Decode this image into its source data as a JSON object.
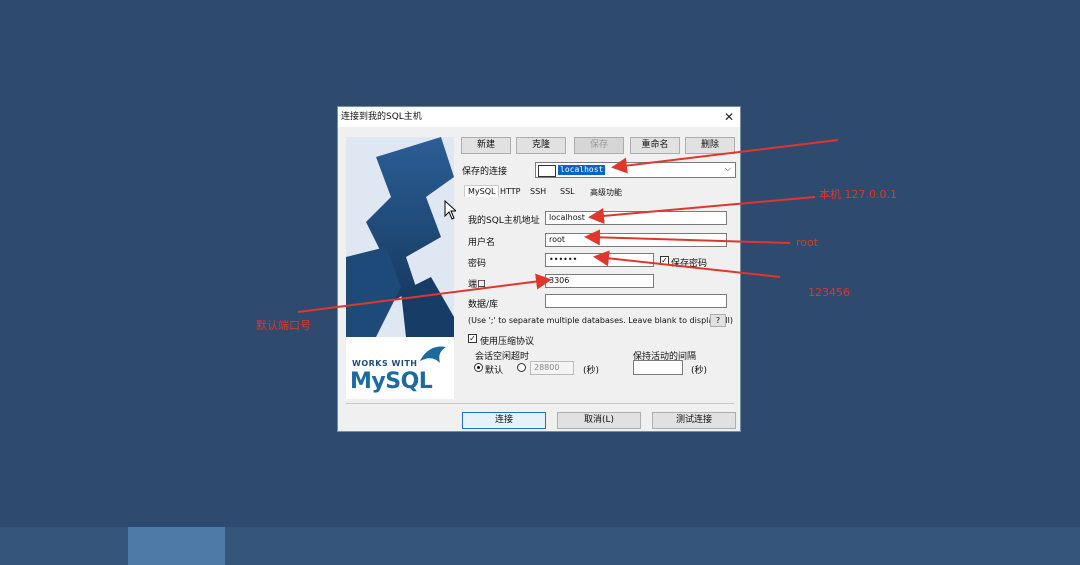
{
  "dialog": {
    "title": "连接到我的SQL主机",
    "close_glyph": "✕",
    "buttons": {
      "new": "新建",
      "clone": "克隆",
      "save": "保存",
      "rename": "重命名",
      "delete": "删除"
    },
    "saved_label": "保存的连接",
    "saved_value": "localhost",
    "tabs": [
      "MySQL",
      "HTTP",
      "SSH",
      "SSL",
      "高级功能"
    ],
    "host_label": "我的SQL主机地址",
    "host_value": "localhost",
    "user_label": "用户名",
    "user_value": "root",
    "password_label": "密码",
    "password_value": "••••••",
    "save_password_label": "保存密码",
    "port_label": "端口",
    "port_value": "3306",
    "database_label": "数据/库",
    "database_value": "",
    "db_hint": "(Use ';' to separate multiple databases. Leave blank to display all)",
    "help_glyph": "?",
    "compress_label": "使用压缩协议",
    "session_timeout_label": "会话空闲超时",
    "default_label": "默认",
    "timeout_value": "28800",
    "seconds_label": "(秒)",
    "keepalive_label": "保持活动的间隔",
    "keepalive_value": "",
    "connect_label": "连接",
    "cancel_label": "取消(L)",
    "test_label": "测试连接",
    "logo_works_with": "WORKS WITH",
    "logo_mysql": "MySQL"
  },
  "annotations": {
    "host_note": "本机 127.0.0.1",
    "user_note": "root",
    "password_note": "123456",
    "port_note": "默认端口号"
  },
  "colors": {
    "annotation": "#e0362c",
    "background": "#2e4a6e",
    "selection": "#0a64c8"
  }
}
